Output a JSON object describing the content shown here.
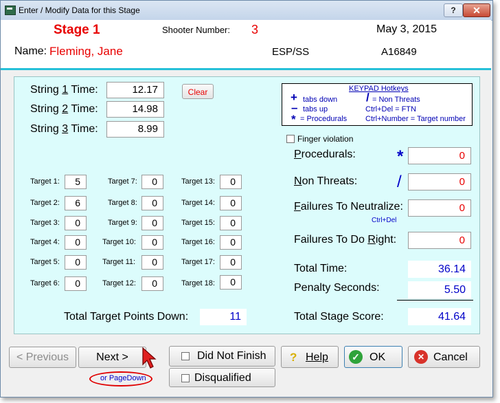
{
  "window": {
    "title": "Enter / Modify Data for this Stage",
    "help_glyph": "?",
    "close_glyph": "✕"
  },
  "header": {
    "stage": "Stage  1",
    "shooter_label": "Shooter Number:",
    "shooter_number": "3",
    "date": "May  3, 2015",
    "name_label": "Name:",
    "name": "Fleming, Jane",
    "division": "ESP/SS",
    "member_id": "A16849"
  },
  "strings": [
    {
      "label_pre": "String ",
      "num": "1",
      "label_post": " Time:",
      "value": "12.17"
    },
    {
      "label_pre": "String ",
      "num": "2",
      "label_post": " Time:",
      "value": "14.98"
    },
    {
      "label_pre": "String ",
      "num": "3",
      "label_post": " Time:",
      "value": "8.99"
    }
  ],
  "clear_label": "Clear",
  "targets": [
    {
      "label": "Target 1:",
      "value": "5"
    },
    {
      "label": "Target 2:",
      "value": "6"
    },
    {
      "label": "Target 3:",
      "value": "0"
    },
    {
      "label": "Target 4:",
      "value": "0"
    },
    {
      "label": "Target 5:",
      "value": "0"
    },
    {
      "label": "Target 6:",
      "value": "0"
    },
    {
      "label": "Target 7:",
      "value": "0"
    },
    {
      "label": "Target 8:",
      "value": "0"
    },
    {
      "label": "Target 9:",
      "value": "0"
    },
    {
      "label": "Target 10:",
      "value": "0"
    },
    {
      "label": "Target 11:",
      "value": "0"
    },
    {
      "label": "Target 12:",
      "value": "0"
    },
    {
      "label": "Target 13:",
      "value": "0"
    },
    {
      "label": "Target 14:",
      "value": "0"
    },
    {
      "label": "Target 15:",
      "value": "0"
    },
    {
      "label": "Target 16:",
      "value": "0"
    },
    {
      "label": "Target 17:",
      "value": "0"
    },
    {
      "label": "Target 18:",
      "value": "0"
    }
  ],
  "total_target_label": "Total Target Points Down:",
  "total_target_value": "11",
  "hotkeys": {
    "title": "KEYPAD Hotkeys",
    "plus_symbol": "+",
    "plus_desc": "tabs down",
    "minus_symbol": "–",
    "minus_desc": "tabs up",
    "star_symbol": "*",
    "star_desc": "= Procedurals",
    "slash_symbol": "/",
    "slash_desc": "= Non Threats",
    "ctrl_del": "Ctrl+Del = FTN",
    "ctrl_num": "Ctrl+Number = Target number"
  },
  "finger_violation_label": "Finger violation",
  "penalties": {
    "procedurals_label_u": "P",
    "procedurals_label_rest": "rocedurals:",
    "procedurals_symbol": "*",
    "procedurals_value": "0",
    "nonthreats_label_u": "N",
    "nonthreats_label_rest": "on Threats:",
    "nonthreats_symbol": "/",
    "nonthreats_value": "0",
    "ftn_label_u": "F",
    "ftn_label_rest": "ailures To Neutralize:",
    "ftn_hint": "Ctrl+Del",
    "ftn_value": "0",
    "ftdr_label_pre": "Failures To Do ",
    "ftdr_label_u": "R",
    "ftdr_label_rest": "ight:",
    "ftdr_value": "0"
  },
  "totals": {
    "total_time_label": "Total Time:",
    "total_time": "36.14",
    "penalty_label": "Penalty Seconds:",
    "penalty": "5.50",
    "score_label": "Total Stage Score:",
    "score": "41.64"
  },
  "buttons": {
    "previous": "< Previous",
    "next": "Next >",
    "pagedown_hint": "or PageDown",
    "did_not_finish": "Did Not Finish",
    "disqualified": "Disqualified",
    "help": "Help",
    "help_icon": "?",
    "ok": "OK",
    "ok_icon": "✓",
    "cancel": "Cancel",
    "cancel_icon": "✕"
  }
}
